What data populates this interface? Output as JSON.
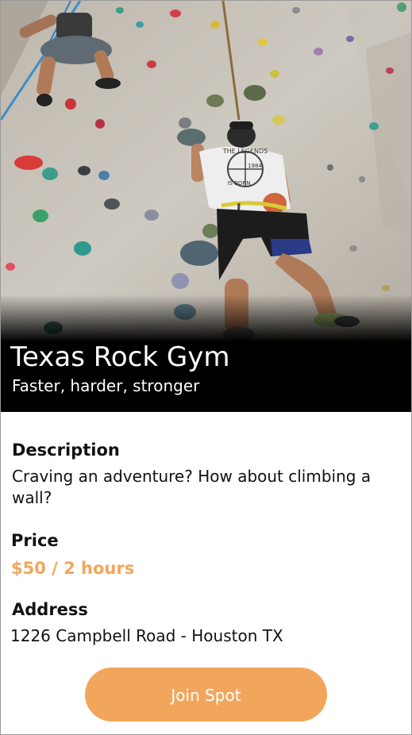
{
  "gym": {
    "title": "Texas Rock Gym",
    "subtitle": "Faster, harder, stronger"
  },
  "hero_image": {
    "subject": "climbers-on-climbing-wall-photo",
    "shirt_text_lines": [
      "THE LEGENDS",
      "1984",
      "IS BORN"
    ]
  },
  "description": {
    "heading": "Description",
    "text": "Craving an adventure? How about climbing a wall?"
  },
  "price": {
    "heading": "Price",
    "value": "$50 / 2 hours"
  },
  "address": {
    "heading": "Address",
    "value": "1226 Campbell Road - Houston TX"
  },
  "actions": {
    "join_label": "Join Spot"
  },
  "colors": {
    "accent": "#f2a65c",
    "title_band": "#000000",
    "text": "#111111"
  }
}
